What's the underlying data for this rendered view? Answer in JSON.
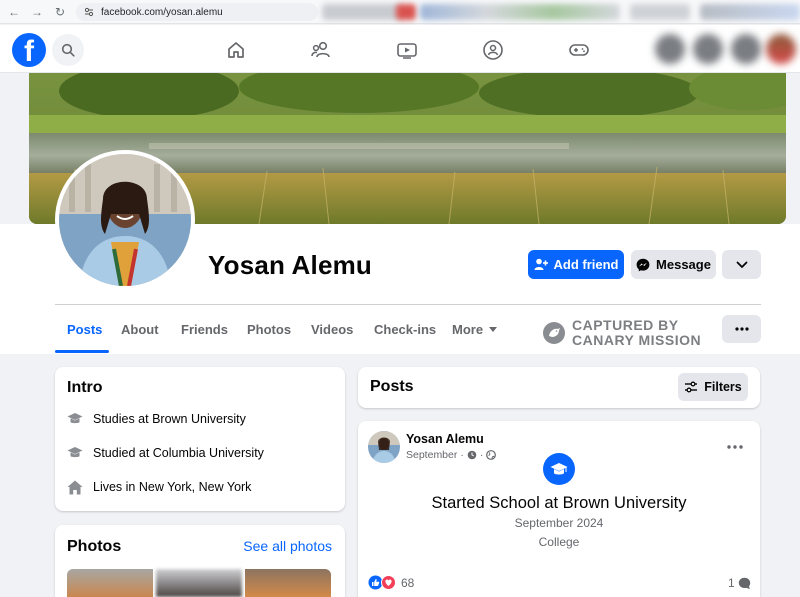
{
  "browser": {
    "url": "facebook.com/yosan.alemu"
  },
  "nav": {
    "icons": [
      "home-icon",
      "friends-icon",
      "watch-icon",
      "groups-icon",
      "gaming-icon"
    ]
  },
  "profile": {
    "name": "Yosan Alemu",
    "add_friend_label": "Add friend",
    "message_label": "Message"
  },
  "tabs": [
    {
      "label": "Posts",
      "active": true
    },
    {
      "label": "About"
    },
    {
      "label": "Friends"
    },
    {
      "label": "Photos"
    },
    {
      "label": "Videos"
    },
    {
      "label": "Check-ins"
    },
    {
      "label": "More"
    }
  ],
  "watermark": {
    "line1": "CAPTURED BY",
    "line2": "CANARY MISSION"
  },
  "intro": {
    "title": "Intro",
    "items": [
      {
        "prefix": "Studies at",
        "bold": "Brown University",
        "icon": "graduation-cap-icon"
      },
      {
        "prefix": "Studied at",
        "bold": "Columbia University",
        "icon": "graduation-cap-icon"
      },
      {
        "prefix": "Lives in",
        "bold": "New York, New York",
        "icon": "home-icon"
      }
    ]
  },
  "photos": {
    "title": "Photos",
    "see_all_label": "See all photos"
  },
  "posts": {
    "title": "Posts",
    "filters_label": "Filters",
    "post": {
      "author": "Yosan Alemu",
      "date": "September",
      "headline": "Started School at Brown University",
      "subline": "September 2024",
      "category": "College",
      "reaction_count": "68",
      "comment_count": "1"
    }
  },
  "colors": {
    "brand_blue": "#0866ff",
    "background": "#f0f2f5"
  }
}
